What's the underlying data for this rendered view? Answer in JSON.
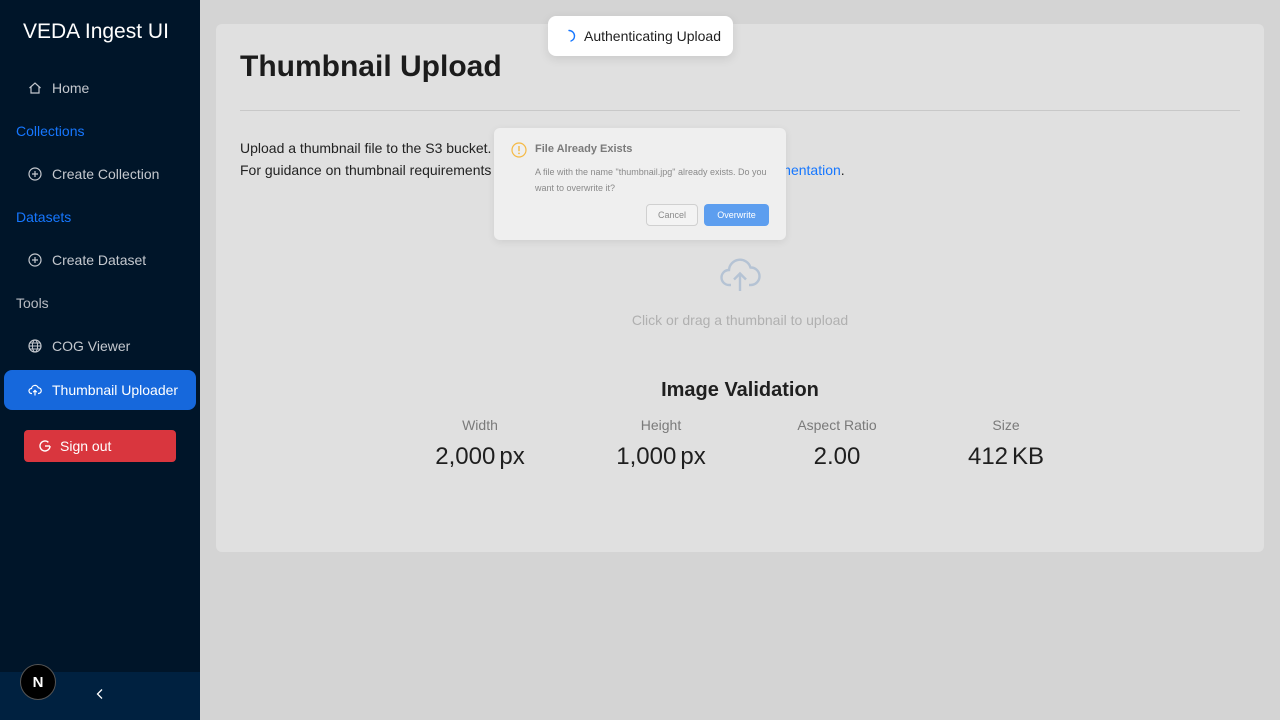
{
  "app": {
    "title": "VEDA Ingest UI"
  },
  "sidebar": {
    "home": "Home",
    "collections_label": "Collections",
    "create_collection": "Create Collection",
    "datasets_label": "Datasets",
    "create_dataset": "Create Dataset",
    "tools_label": "Tools",
    "cog_viewer": "COG Viewer",
    "thumbnail_uploader": "Thumbnail Uploader",
    "sign_out": "Sign out",
    "badge": "N",
    "collapse_icon": "chevron-left-icon"
  },
  "main": {
    "title": "Thumbnail Upload",
    "desc_line1": "Upload a thumbnail file to the S3 bucket.",
    "desc_line2_prefix": "For guidance on thumbnail requirements and resizing images, refer to the ",
    "desc_link": "veda-ui documentation",
    "desc_line2_suffix": ".",
    "upload_text": "Click or drag a thumbnail to upload",
    "validation_title": "Image Validation",
    "stats": [
      {
        "label": "Width",
        "value": "2,000",
        "unit": "px"
      },
      {
        "label": "Height",
        "value": "1,000",
        "unit": "px"
      },
      {
        "label": "Aspect Ratio",
        "value": "2.00",
        "unit": ""
      },
      {
        "label": "Size",
        "value": "412",
        "unit": "KB"
      }
    ]
  },
  "modal": {
    "title": "File Already Exists",
    "body": "A file with the name \"thumbnail.jpg\" already exists. Do you want to overwrite it?",
    "cancel": "Cancel",
    "overwrite": "Overwrite"
  },
  "toast": {
    "text": "Authenticating Upload"
  },
  "colors": {
    "sidebar": "#001529",
    "accent": "#1668dc",
    "danger": "#d9363e",
    "link": "#1677ff"
  }
}
